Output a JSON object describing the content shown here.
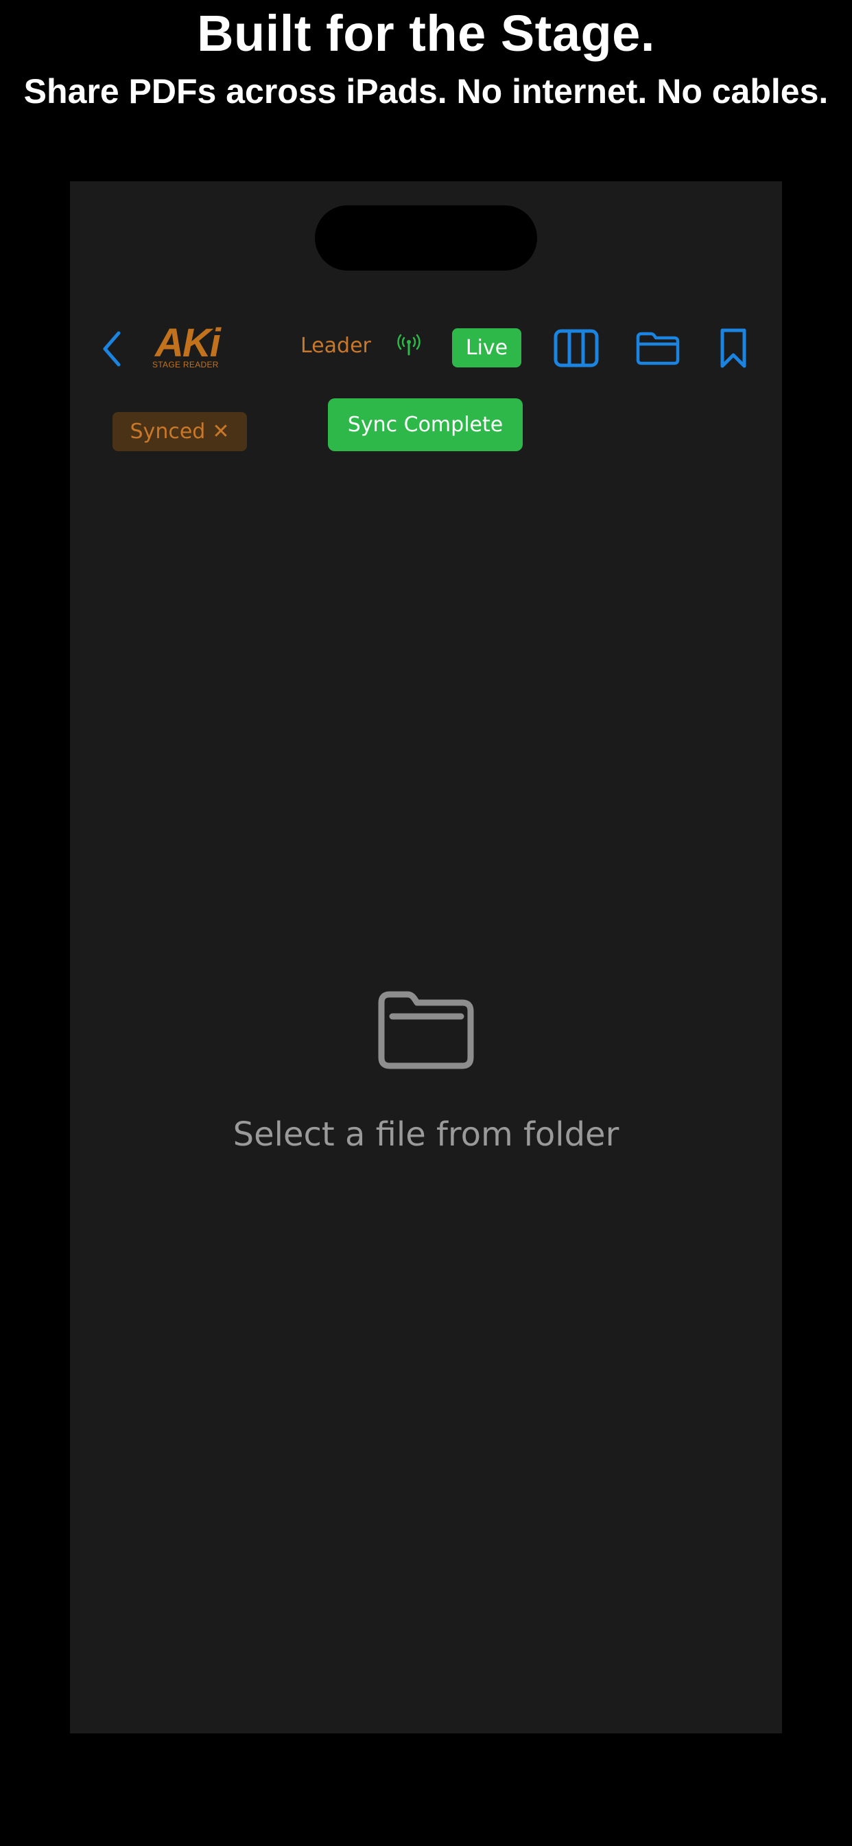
{
  "marketing": {
    "headline": "Built for the Stage.",
    "subhead": "Share PDFs across iPads. No internet. No cables."
  },
  "toolbar": {
    "logo_main": "AKi",
    "logo_sub": "STAGE READER",
    "role_label": "Leader",
    "live_label": "Live",
    "icons": [
      "chevron-left-icon",
      "antenna-icon",
      "columns-icon",
      "folder-icon",
      "bookmark-icon"
    ]
  },
  "status": {
    "synced_label": "Synced",
    "synced_close": "✕",
    "toast_label": "Sync Complete"
  },
  "empty_state": {
    "message": "Select a file from folder",
    "icon": "folder-icon"
  },
  "colors": {
    "accent_blue": "#1a84e0",
    "accent_orange": "#c9782a",
    "live_green": "#2fb84a",
    "background": "#1b1b1b"
  }
}
